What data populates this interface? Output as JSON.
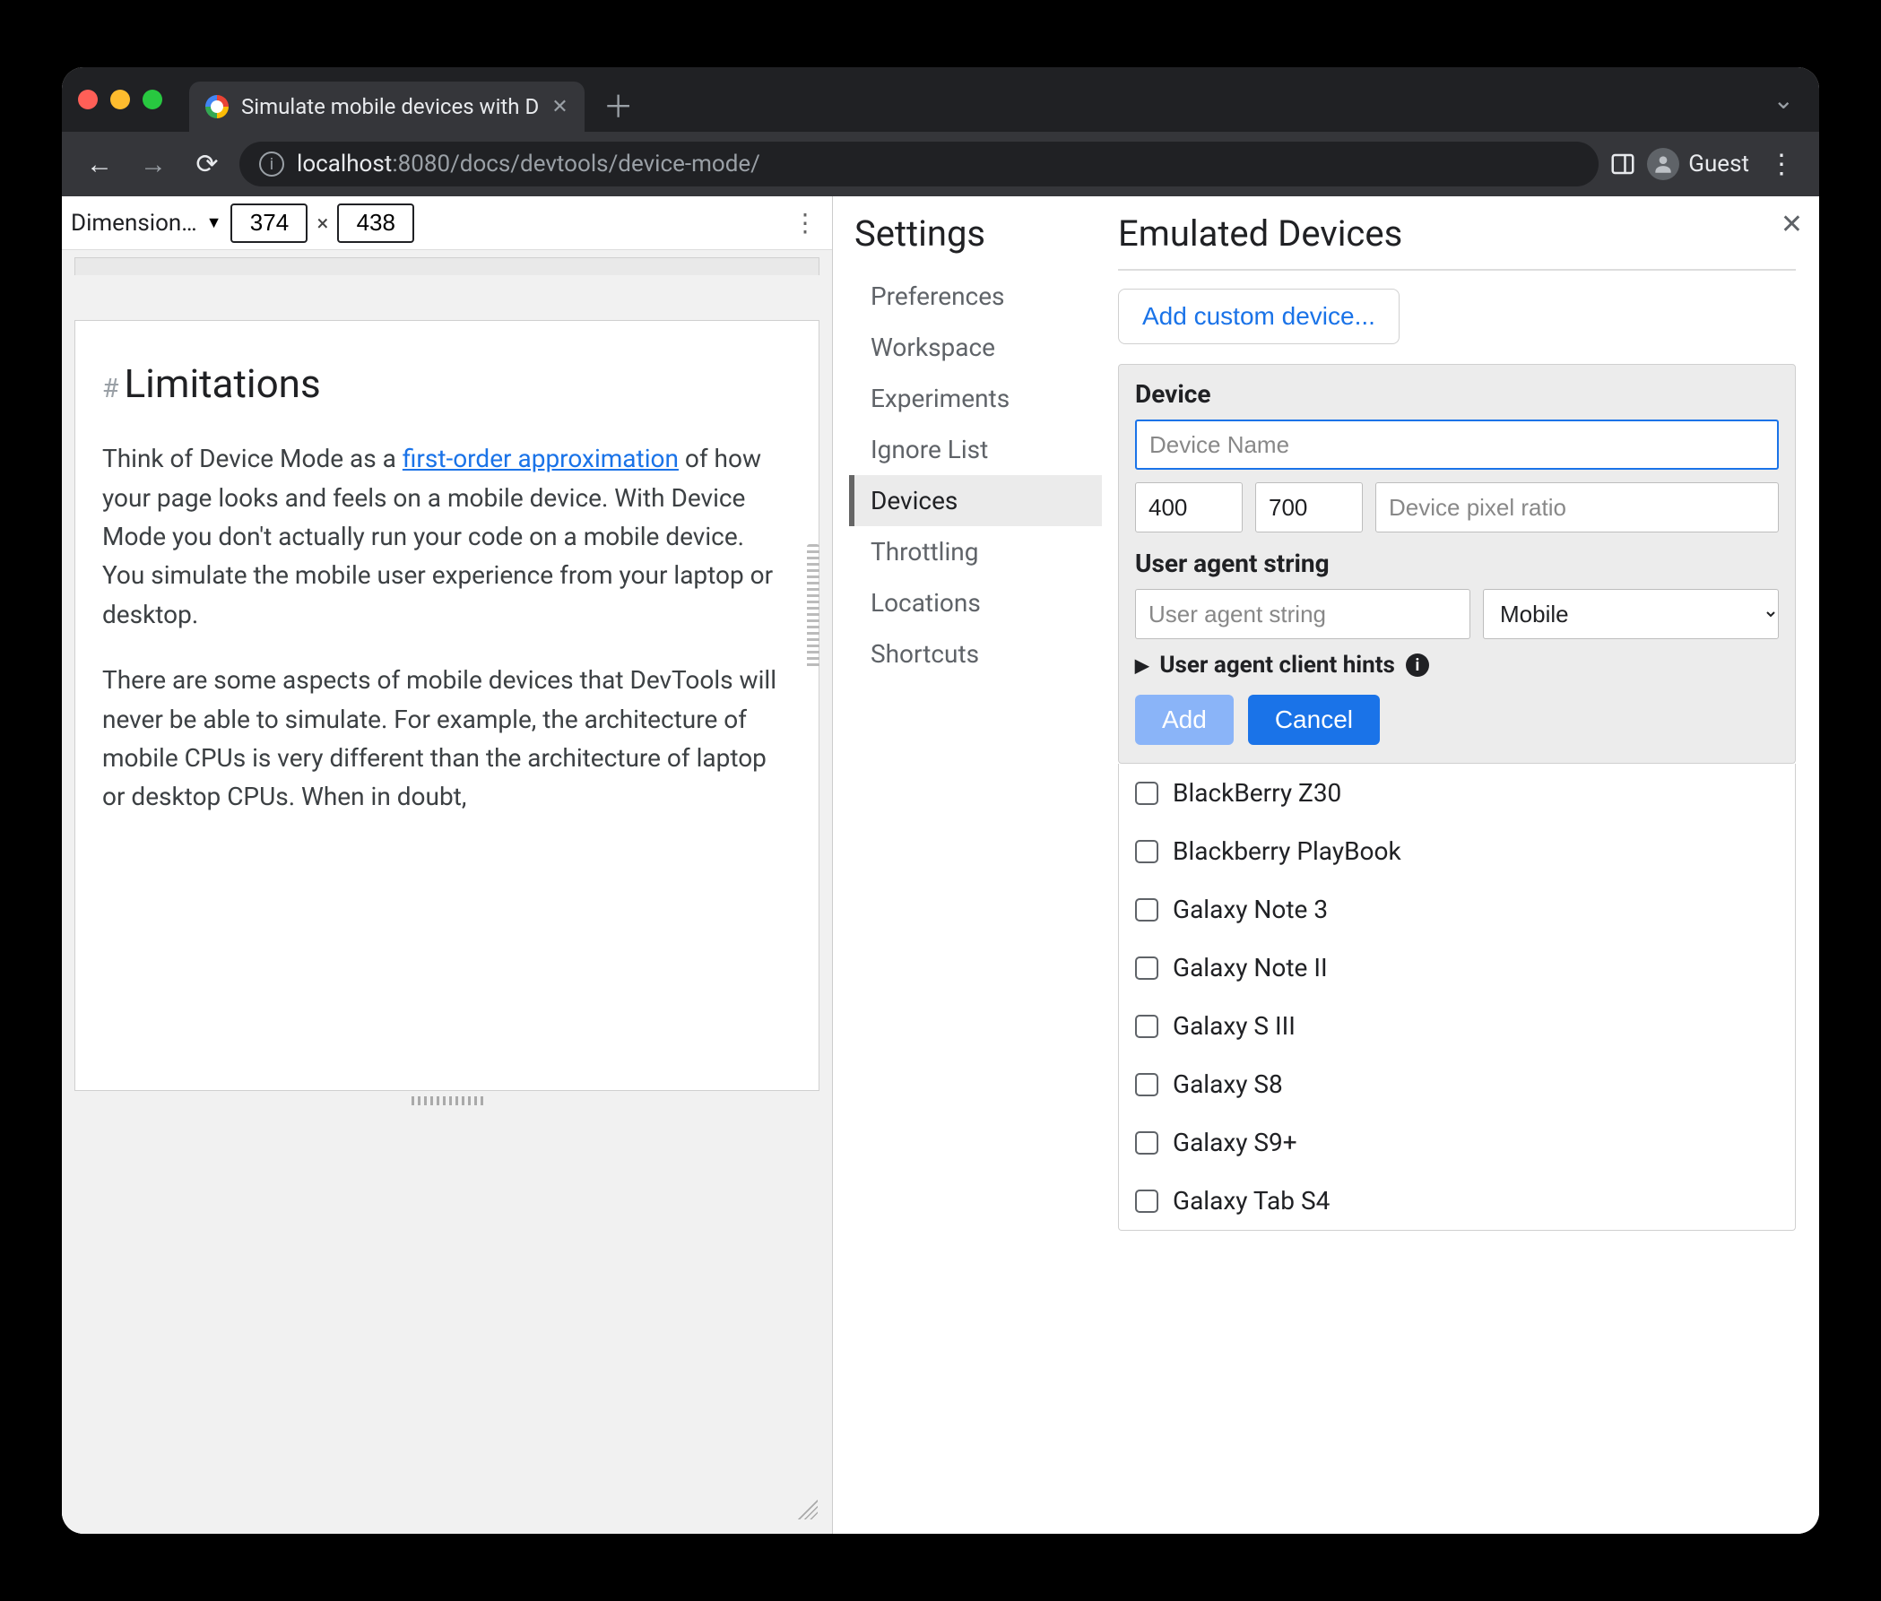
{
  "tab": {
    "title": "Simulate mobile devices with D"
  },
  "url": {
    "host": "localhost",
    "port": ":8080",
    "path": "/docs/devtools/device-mode/"
  },
  "profile": {
    "label": "Guest"
  },
  "device_toolbar": {
    "label": "Dimension…",
    "width": "374",
    "height": "438",
    "separator": "×"
  },
  "page": {
    "heading": "Limitations",
    "p1_a": "Think of Device Mode as a ",
    "p1_link": "first-order approximation",
    "p1_b": " of how your page looks and feels on a mobile device. With Device Mode you don't actually run your code on a mobile device. You simulate the mobile user experience from your laptop or desktop.",
    "p2": "There are some aspects of mobile devices that DevTools will never be able to simulate. For example, the architecture of mobile CPUs is very different than the architecture of laptop or desktop CPUs. When in doubt,"
  },
  "settings": {
    "title": "Settings",
    "nav": [
      "Preferences",
      "Workspace",
      "Experiments",
      "Ignore List",
      "Devices",
      "Throttling",
      "Locations",
      "Shortcuts"
    ],
    "active": "Devices"
  },
  "emulated": {
    "title": "Emulated Devices",
    "add_custom": "Add custom device...",
    "device_label": "Device",
    "name_placeholder": "Device Name",
    "width": "400",
    "height": "700",
    "dpr_placeholder": "Device pixel ratio",
    "ua_label": "User agent string",
    "ua_placeholder": "User agent string",
    "ua_type": "Mobile",
    "hints_label": "User agent client hints",
    "add_btn": "Add",
    "cancel_btn": "Cancel",
    "devices": [
      "BlackBerry Z30",
      "Blackberry PlayBook",
      "Galaxy Note 3",
      "Galaxy Note II",
      "Galaxy S III",
      "Galaxy S8",
      "Galaxy S9+",
      "Galaxy Tab S4"
    ]
  }
}
